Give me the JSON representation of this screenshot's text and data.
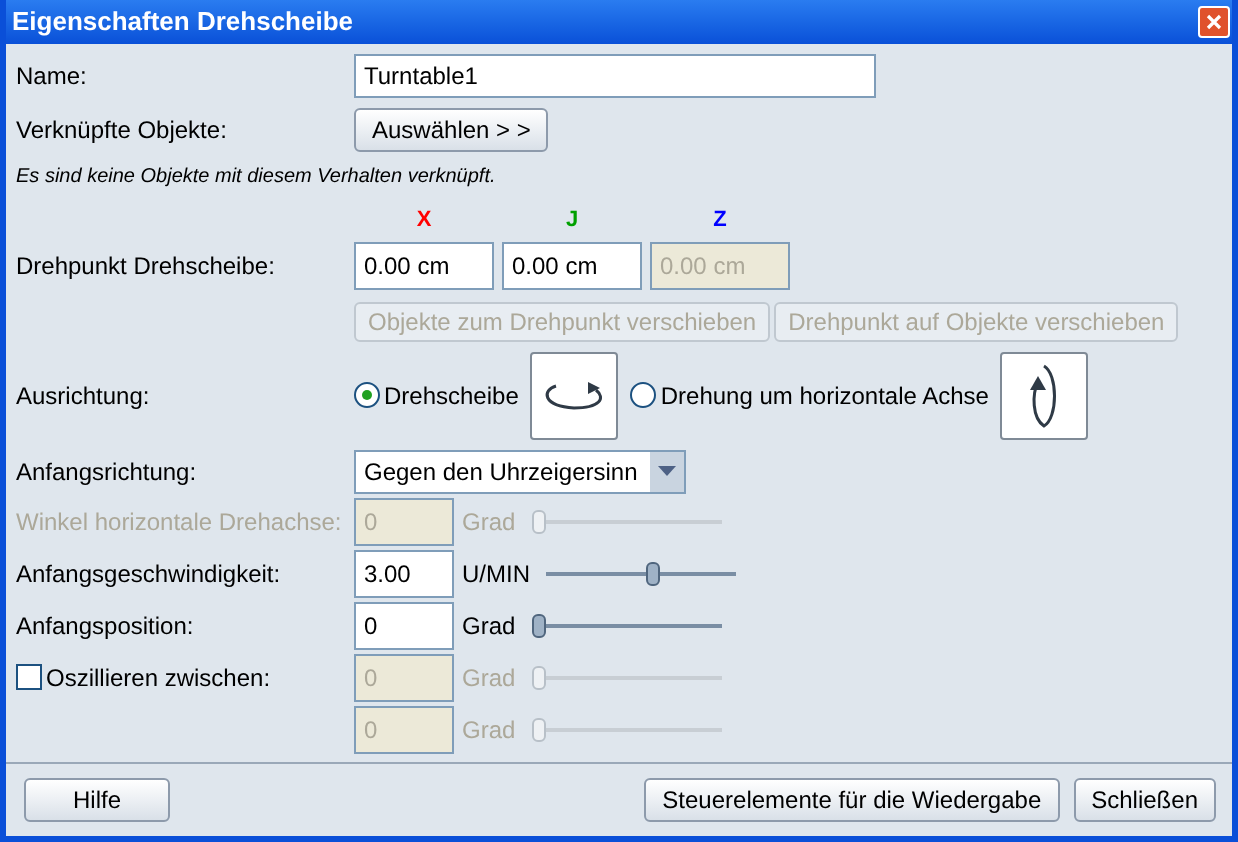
{
  "window": {
    "title": "Eigenschaften Drehscheibe"
  },
  "name": {
    "label": "Name:",
    "value": "Turntable1"
  },
  "linked": {
    "label": "Verknüpfte Objekte:",
    "button": "Auswählen > >"
  },
  "note": "Es sind keine Objekte mit diesem Verhalten verknüpft.",
  "pivot": {
    "label": "Drehpunkt Drehscheibe:",
    "axes": [
      {
        "label": "X",
        "color": "#ff0000",
        "value": "0.00 cm",
        "disabled": false
      },
      {
        "label": "J",
        "color": "#00a000",
        "value": "0.00 cm",
        "disabled": false
      },
      {
        "label": "Z",
        "color": "#0000ff",
        "value": "0.00 cm",
        "disabled": true
      }
    ]
  },
  "pivot_buttons": [
    {
      "label": "Objekte zum Drehpunkt verschieben",
      "disabled": true
    },
    {
      "label": "Drehpunkt auf Objekte verschieben",
      "disabled": true
    }
  ],
  "orientation": {
    "label": "Ausrichtung:",
    "options": [
      {
        "label": "Drehscheibe",
        "selected": true,
        "kind": "flat"
      },
      {
        "label": "Drehung um horizontale Achse",
        "selected": false,
        "kind": "vertical"
      }
    ]
  },
  "start_direction": {
    "label": "Anfangsrichtung:",
    "value": "Gegen den Uhrzeigersinn"
  },
  "rows": [
    {
      "kind": "text",
      "label": "Winkel horizontale Drehachse:",
      "value": "0",
      "unit": "Grad",
      "disabled": true,
      "level": 0
    },
    {
      "kind": "text",
      "label": "Anfangsgeschwindigkeit:",
      "value": "3.00",
      "unit": "U/MIN",
      "disabled": false,
      "level": 0.57
    },
    {
      "kind": "text",
      "label": "Anfangsposition:",
      "value": "0",
      "unit": "Grad",
      "disabled": false,
      "level": 0
    },
    {
      "kind": "checkbox",
      "label": "Oszillieren zwischen:",
      "checked": false,
      "value": "0",
      "unit": "Grad",
      "disabled": true,
      "level": 0
    },
    {
      "kind": "blank",
      "value": "0",
      "unit": "Grad",
      "disabled": true,
      "level": 0
    }
  ],
  "footer": {
    "help": "Hilfe",
    "buttons": [
      "Steuerelemente für die Wiedergabe",
      "Schließen"
    ]
  }
}
